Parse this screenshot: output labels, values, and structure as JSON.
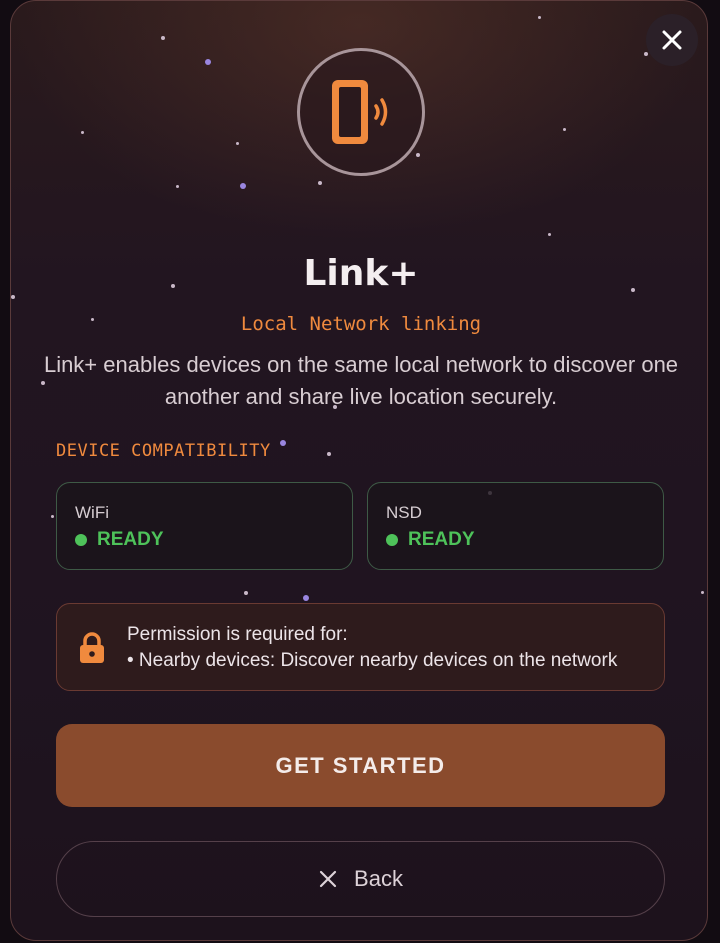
{
  "dialog": {
    "close_icon": "close-icon",
    "hero_icon": "phone-signal-icon",
    "title": "Link+",
    "subtitle": "Local Network linking",
    "description": "Link+ enables devices on the same local network to discover one another and share live location securely."
  },
  "compatibility": {
    "label": "DEVICE COMPATIBILITY",
    "items": [
      {
        "name": "WiFi",
        "status": "READY"
      },
      {
        "name": "NSD",
        "status": "READY"
      }
    ]
  },
  "permission": {
    "icon": "lock-icon",
    "heading": "Permission is required for:",
    "item": "• Nearby devices: Discover nearby devices on the network"
  },
  "actions": {
    "primary_label": "GET STARTED",
    "secondary_label": "Back",
    "secondary_icon": "close-icon"
  },
  "colors": {
    "accent": "#f08a3e",
    "ready": "#4ec25a",
    "primary_button": "#8a4b2d"
  }
}
